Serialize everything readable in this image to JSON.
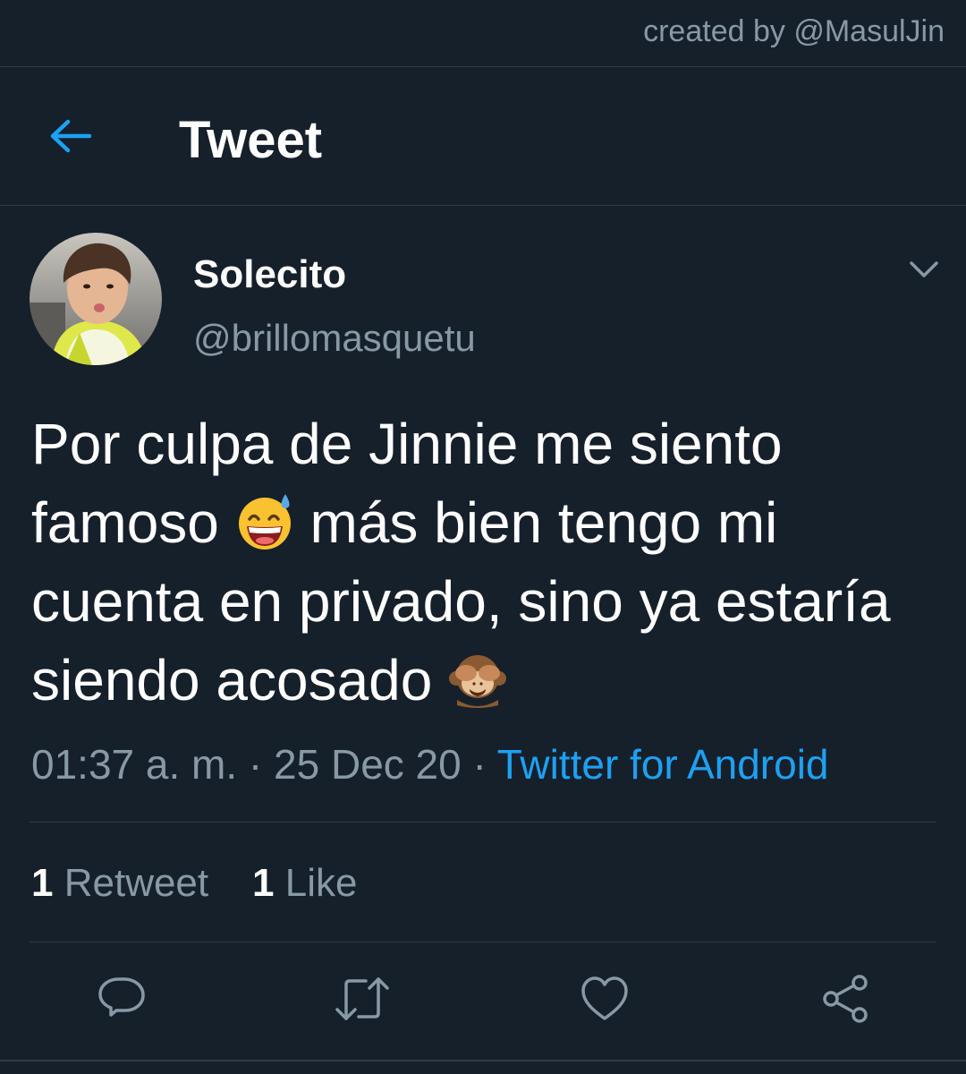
{
  "credit": "created by @MasulJin",
  "header": {
    "title": "Tweet",
    "back_icon": "arrow-left-icon"
  },
  "tweet": {
    "author": {
      "name": "Solecito",
      "handle": "@brillomasquetu"
    },
    "text": {
      "part1": "Por culpa de Jinnie me siento famoso ",
      "emoji1": "grinning-face-with-sweat",
      "part2": " más bien tengo mi cuenta en privado, sino ya estaría siendo acosado ",
      "emoji2": "see-no-evil-monkey"
    },
    "time": "01:37 a. m.",
    "separator": "·",
    "date": "25 Dec 20",
    "source": "Twitter for Android",
    "stats": {
      "retweets_count": "1",
      "retweets_label": "Retweet",
      "likes_count": "1",
      "likes_label": "Like"
    }
  },
  "actions": [
    {
      "name": "reply",
      "icon": "reply-icon"
    },
    {
      "name": "retweet",
      "icon": "retweet-icon"
    },
    {
      "name": "like",
      "icon": "heart-icon"
    },
    {
      "name": "share",
      "icon": "share-icon"
    }
  ],
  "colors": {
    "background": "#16202b",
    "text": "#ffffff",
    "secondary": "#8899a6",
    "accent": "#1da1f2",
    "divider": "#2f3b47"
  }
}
